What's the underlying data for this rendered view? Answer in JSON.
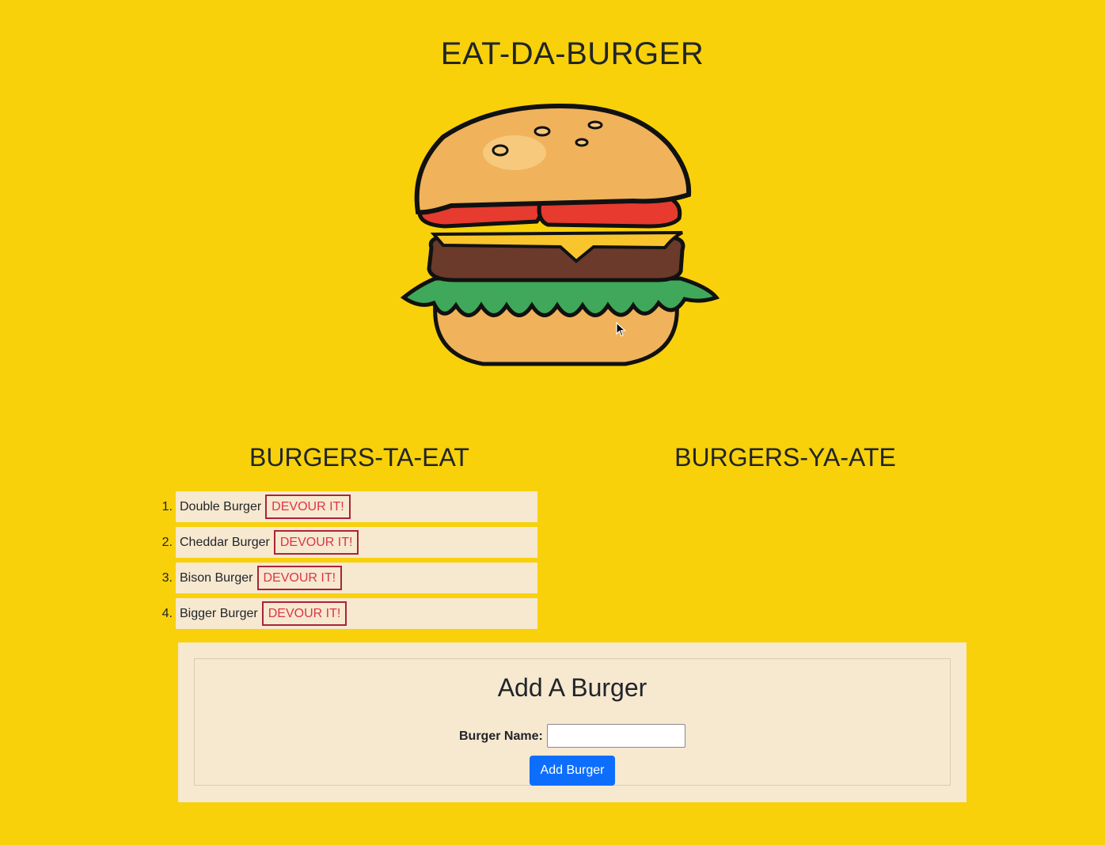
{
  "page": {
    "title": "EAT-DA-BURGER",
    "background_color": "#f8d10a"
  },
  "columns": {
    "to_eat_heading": "BURGERS-TA-EAT",
    "ate_heading": "BURGERS-YA-ATE"
  },
  "to_eat": [
    {
      "num": "1.",
      "name": "Double Burger",
      "button": "DEVOUR IT!"
    },
    {
      "num": "2.",
      "name": "Cheddar Burger",
      "button": "DEVOUR IT!"
    },
    {
      "num": "3.",
      "name": "Bison Burger",
      "button": "DEVOUR IT!"
    },
    {
      "num": "4.",
      "name": "Bigger Burger",
      "button": "DEVOUR IT!"
    }
  ],
  "eaten": [],
  "form": {
    "title": "Add A Burger",
    "label": "Burger Name:",
    "input_value": "",
    "submit_label": "Add Burger"
  },
  "icons": {
    "hero": "burger-illustration",
    "pointer": "mouse-cursor-icon"
  },
  "colors": {
    "accent": "#0d6efd",
    "danger": "#dc3545",
    "panel": "#f7e8d0"
  }
}
